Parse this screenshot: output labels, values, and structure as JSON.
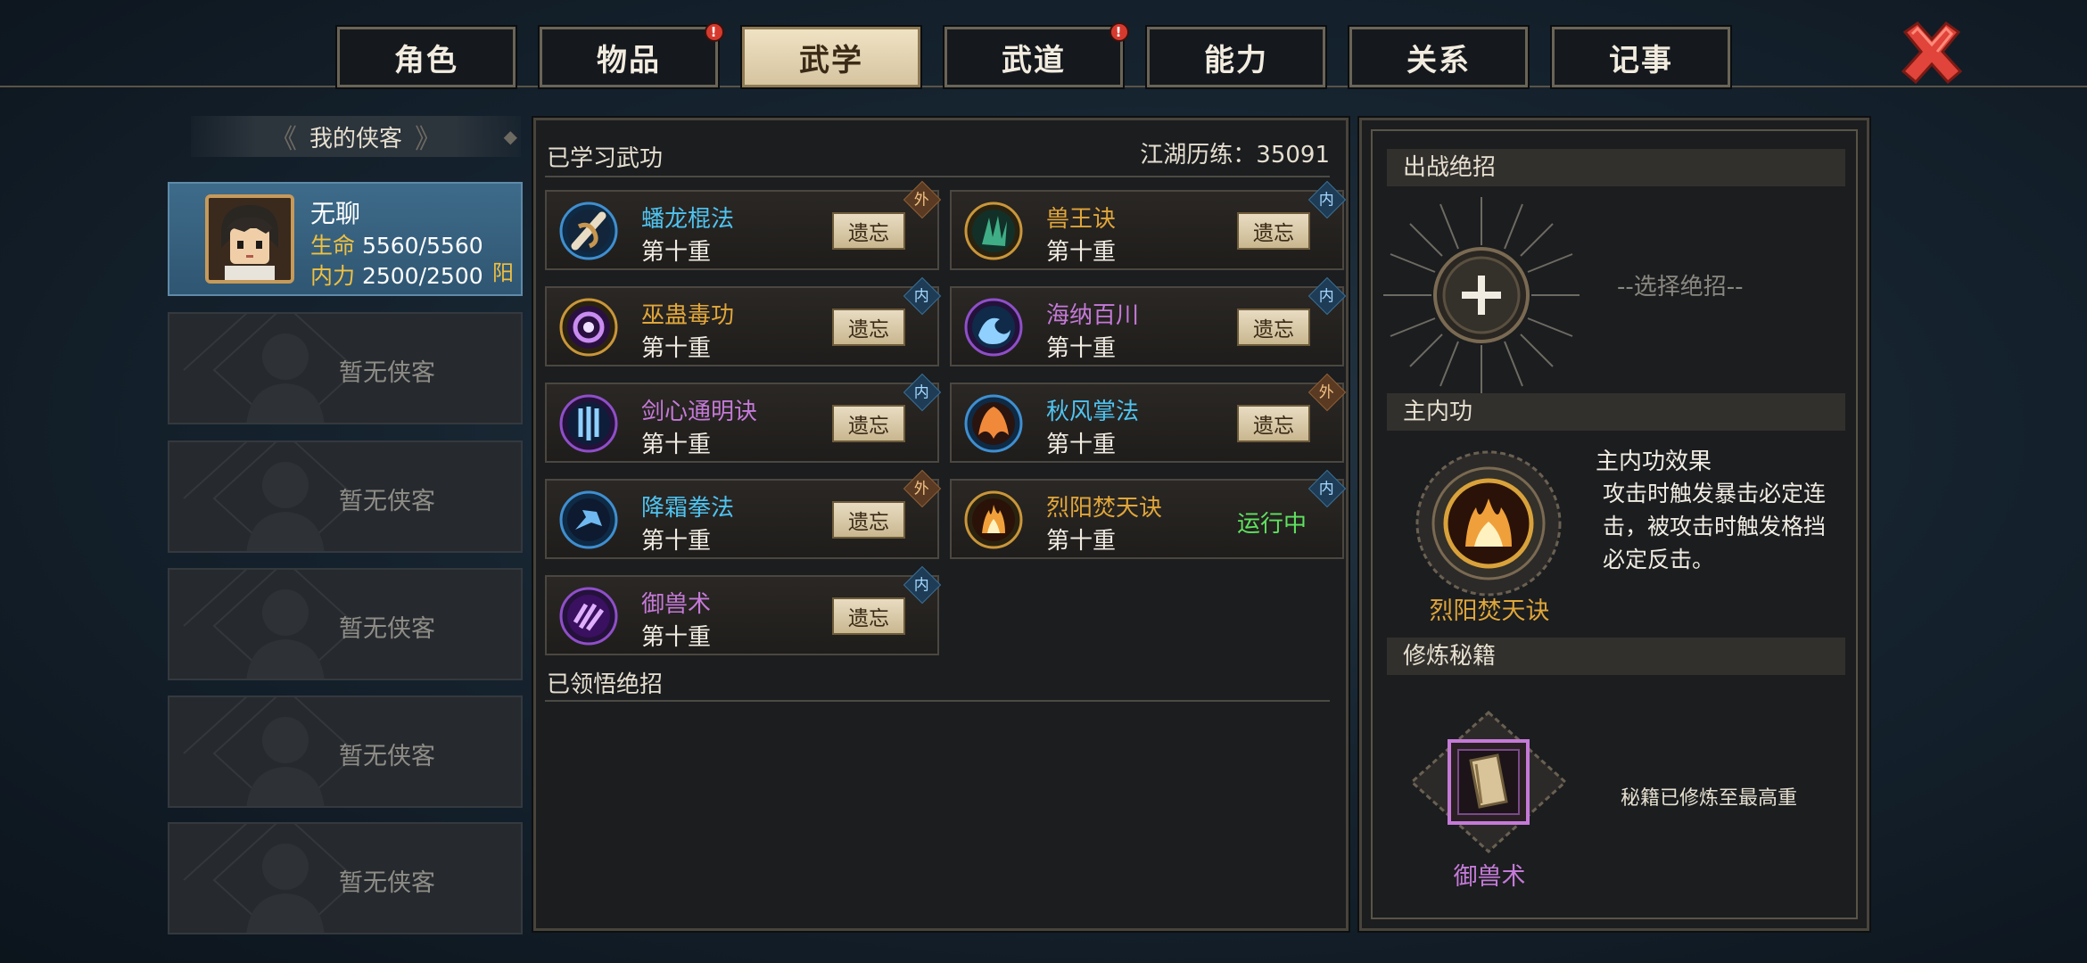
{
  "tabs": [
    {
      "label": "角色",
      "active": false,
      "alert": false
    },
    {
      "label": "物品",
      "active": false,
      "alert": true
    },
    {
      "label": "武学",
      "active": true,
      "alert": false
    },
    {
      "label": "武道",
      "active": false,
      "alert": true
    },
    {
      "label": "能力",
      "active": false,
      "alert": false
    },
    {
      "label": "关系",
      "active": false,
      "alert": false
    },
    {
      "label": "记事",
      "active": false,
      "alert": false
    }
  ],
  "alert_mark": "!",
  "left": {
    "header": "我的侠客",
    "hero": {
      "name": "无聊",
      "hp_label": "生命",
      "hp_value": "5560/5560",
      "mp_label": "内力",
      "mp_value": "2500/2500",
      "attribute": "阳"
    },
    "empty_slots": [
      "暂无侠客",
      "暂无侠客",
      "暂无侠客",
      "暂无侠客",
      "暂无侠客"
    ]
  },
  "middle": {
    "learned_title": "已学习武功",
    "experience": "江湖历练：35091",
    "comprehended_title": "已领悟绝招",
    "forget_label": "遗忘",
    "skills": [
      {
        "name": "蟠龙棍法",
        "level": "第十重",
        "type": "外",
        "name_color": "#4fc3f0",
        "status": "",
        "icon": "staff-skill-icon"
      },
      {
        "name": "兽王诀",
        "level": "第十重",
        "type": "内",
        "name_color": "#e0a63a",
        "status": "",
        "icon": "beast-king-skill-icon"
      },
      {
        "name": "巫蛊毒功",
        "level": "第十重",
        "type": "内",
        "name_color": "#e0a63a",
        "status": "",
        "icon": "poison-skill-icon"
      },
      {
        "name": "海纳百川",
        "level": "第十重",
        "type": "内",
        "name_color": "#c57ad8",
        "status": "",
        "icon": "wave-skill-icon"
      },
      {
        "name": "剑心通明诀",
        "level": "第十重",
        "type": "内",
        "name_color": "#c57ad8",
        "status": "",
        "icon": "sword-heart-skill-icon"
      },
      {
        "name": "秋风掌法",
        "level": "第十重",
        "type": "外",
        "name_color": "#4fc3f0",
        "status": "",
        "icon": "palm-skill-icon"
      },
      {
        "name": "降霜拳法",
        "level": "第十重",
        "type": "外",
        "name_color": "#4fc3f0",
        "status": "",
        "icon": "frost-fist-skill-icon"
      },
      {
        "name": "烈阳焚天诀",
        "level": "第十重",
        "type": "内",
        "name_color": "#e0a63a",
        "status": "运行中",
        "icon": "blazing-sun-skill-icon"
      },
      {
        "name": "御兽术",
        "level": "第十重",
        "type": "内",
        "name_color": "#c57ad8",
        "status": "",
        "icon": "beast-taming-skill-icon"
      }
    ]
  },
  "right": {
    "battle_title": "出战绝招",
    "select_hint": "--选择绝招--",
    "main_inner_title": "主内功",
    "effect_title": "主内功效果",
    "effect_text": "攻击时触发暴击必定连击，被攻击时触发格挡必定反击。",
    "main_inner_name": "烈阳焚天诀",
    "manual_title": "修炼秘籍",
    "manual_name": "御兽术",
    "manual_status": "秘籍已修炼至最高重"
  },
  "colors": {
    "gold": "#e0a63a",
    "purple": "#c57ad8",
    "blue": "#4fc3f0",
    "running": "#5fe25f",
    "close": "#e0443a"
  }
}
